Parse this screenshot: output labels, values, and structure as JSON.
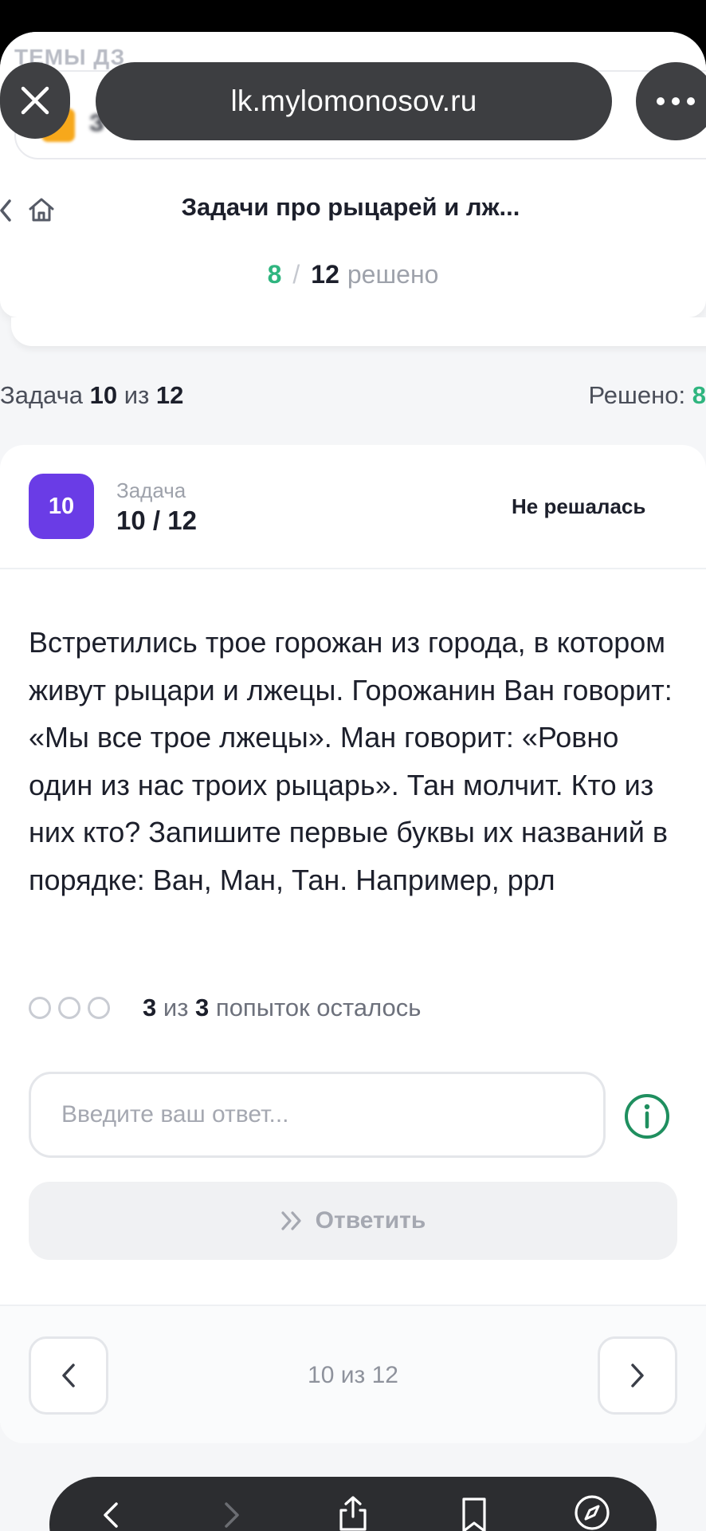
{
  "browser": {
    "url": "lk.mylomonosov.ru",
    "close_icon": "close-icon",
    "more_icon": "more-icon"
  },
  "background": {
    "section_label": "ТЕМЫ ДЗ",
    "blurred_title": "З"
  },
  "header": {
    "title": "Задачи про рыцарей и лж...",
    "progress": {
      "solved": "8",
      "separator": "/",
      "total": "12",
      "label": "решено"
    }
  },
  "task_counter": {
    "prefix": "Задача",
    "current": "10",
    "of": "из",
    "total": "12",
    "solved_label": "Решено:",
    "solved_value": "8"
  },
  "task": {
    "badge": "10",
    "label": "Задача",
    "number": "10 / 12",
    "status": "Не решалась",
    "text": "Встретились трое горожан из города, в котором живут рыцари и лжецы. Горожанин Ван говорит: «Мы все трое лжецы». Ман говорит: «Ровно один из нас троих рыцарь». Тан молчит. Кто из них кто? Запишите первые буквы их названий в порядке: Ван, Ман, Тан. Например, ррл"
  },
  "attempts": {
    "remaining": "3",
    "of": "из",
    "total": "3",
    "label": "попыток осталось"
  },
  "answer": {
    "placeholder": "Введите ваш ответ...",
    "value": "",
    "submit_label": "Ответить"
  },
  "pager": {
    "text": "10 из 12"
  },
  "colors": {
    "accent_green": "#2fb57f",
    "badge_purple": "#6a3ce6"
  }
}
